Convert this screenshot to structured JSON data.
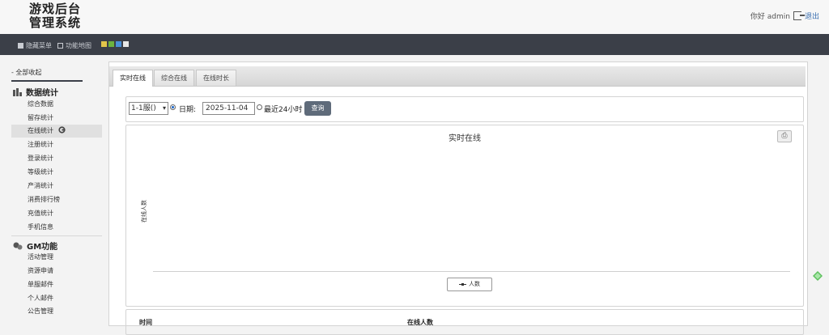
{
  "header": {
    "logo_line1": "游戏后台",
    "logo_line2": "管理系统",
    "greeting": "你好 admin",
    "logout": "退出"
  },
  "navbar": {
    "hide_menu": "隐藏菜单",
    "site_map": "功能地图",
    "theme_colors": [
      "#e3c54a",
      "#6db33f",
      "#4a90d9",
      "#e8e8e8"
    ]
  },
  "sidebar": {
    "collapse_all": "- 全部收起",
    "groups": [
      {
        "title": "数据统计",
        "items": [
          "综合数据",
          "留存统计",
          "在线统计",
          "注册统计",
          "登录统计",
          "等级统计",
          "产消统计",
          "消费排行榜",
          "充值统计",
          "手机信息"
        ]
      },
      {
        "title": "GM功能",
        "items": [
          "活动管理",
          "资源申请",
          "单服邮件",
          "个人邮件",
          "公告管理"
        ]
      }
    ]
  },
  "tabs": [
    "实时在线",
    "综合在线",
    "在线时长"
  ],
  "filter": {
    "server": "1-1服()",
    "date_label": "日期:",
    "date_value": "2025-11-04",
    "last24_label": "最近24小时",
    "query_button": "查询"
  },
  "chart_data": {
    "type": "line",
    "title": "实时在线",
    "ylabel": "在线人数",
    "xlabel": "",
    "series": [
      {
        "name": "人数",
        "values": []
      }
    ],
    "legend": "bottom",
    "grid": false
  },
  "table": {
    "columns": [
      "时间",
      "在线人数"
    ]
  }
}
